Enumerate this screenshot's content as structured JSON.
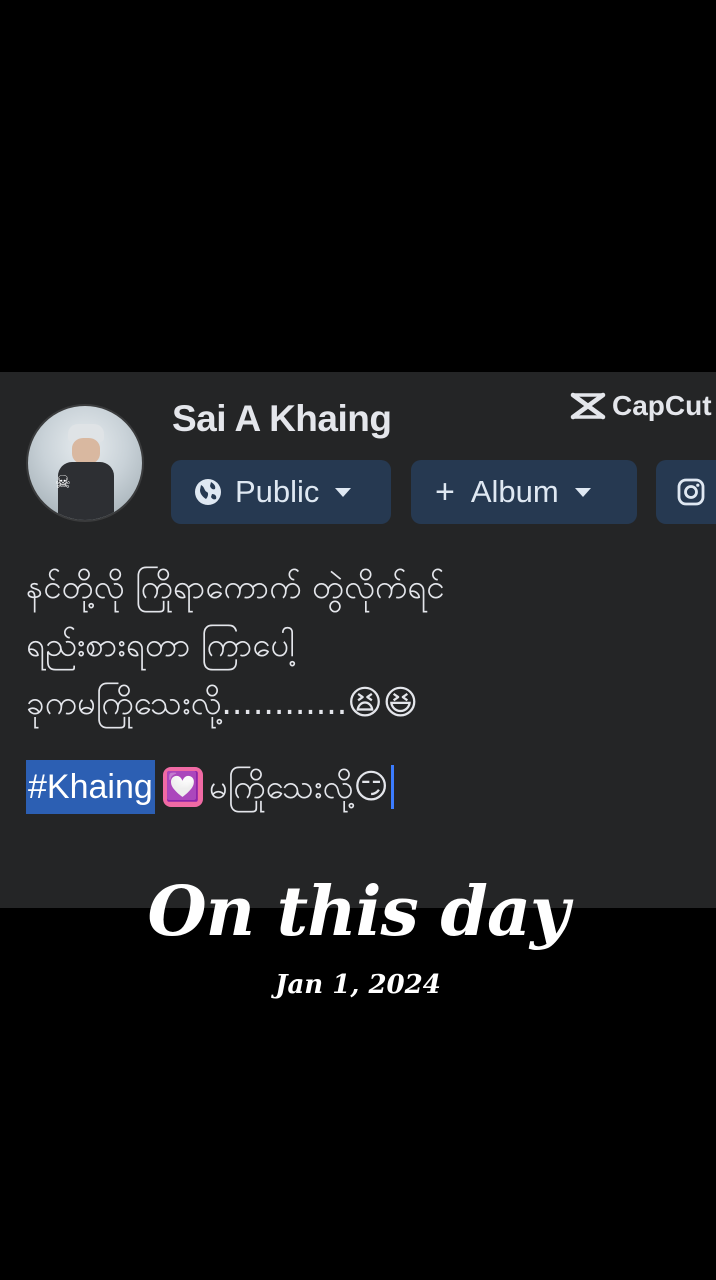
{
  "post": {
    "user_name": "Sai A Khaing",
    "watermark": "CapCut",
    "audience_label": "Public",
    "album_label": "Album",
    "text_lines": [
      "နင်တို့လို ကြိုရာကောက် တွဲလိုက်ရင်",
      "ရည်းစားရတာ ကြာပေါ့",
      "ခုကမကြိုသေးလို့............"
    ],
    "line3_emojis": "😫😆",
    "hashtag": "#Khaing",
    "heart": "💟",
    "hashtag_tail": "မကြိုသေးလို့",
    "tail_emoji": "😏"
  },
  "memory": {
    "title": "On this day",
    "date": "Jan 1, 2024"
  },
  "colors": {
    "page_bg": "#000000",
    "card_bg": "#242526",
    "chip_bg": "#263951",
    "hashtag_highlight": "#2c5fb3",
    "cursor": "#3b7cff"
  },
  "icons": {
    "audience": "globe-icon",
    "audience_dropdown": "caret-down-icon",
    "album_add": "plus-icon",
    "album_dropdown": "caret-down-icon",
    "third_chip": "instagram-icon",
    "watermark": "capcut-logo-icon"
  }
}
